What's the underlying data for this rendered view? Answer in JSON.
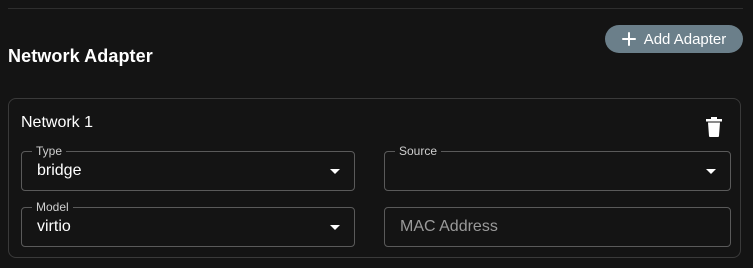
{
  "section": {
    "title": "Network Adapter",
    "add_button_label": "Add Adapter",
    "add_icon": "plus-icon"
  },
  "adapter": {
    "title": "Network 1",
    "delete_icon": "trash-icon",
    "type": {
      "label": "Type",
      "value": "bridge"
    },
    "source": {
      "label": "Source",
      "value": ""
    },
    "model": {
      "label": "Model",
      "value": "virtio"
    },
    "mac": {
      "placeholder": "MAC Address",
      "value": ""
    }
  },
  "colors": {
    "background": "#141414",
    "button": "#6b7f8a",
    "border": "#5a5a5a"
  }
}
